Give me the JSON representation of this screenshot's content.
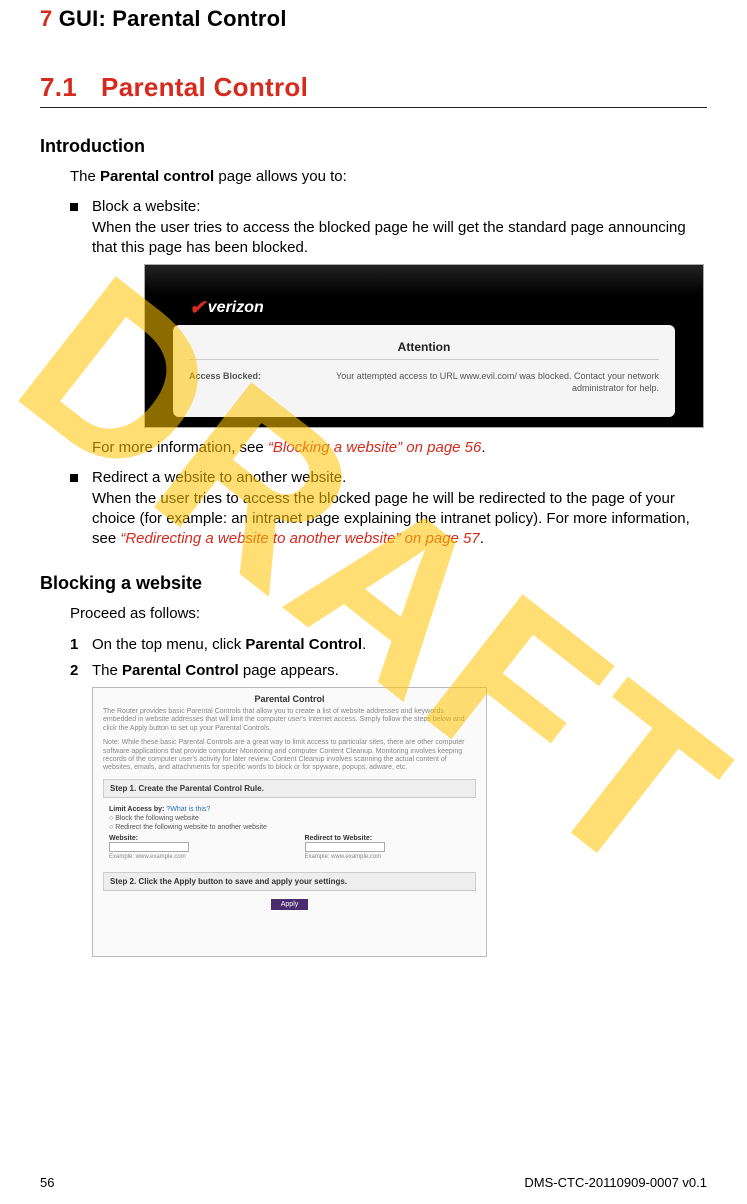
{
  "watermark": "DRAFT",
  "chapter": {
    "num": "7",
    "title": " GUI: Parental Control"
  },
  "section": {
    "num": "7.1",
    "title": "Parental Control"
  },
  "intro": {
    "heading": "Introduction",
    "lead_pre": "The ",
    "lead_bold": "Parental control",
    "lead_post": " page allows you to:",
    "bullets": [
      {
        "title": "Block a website:",
        "body": "When the user tries to access the blocked page he will get the standard page announcing that this page has been blocked.",
        "after_pre": "For more information, see ",
        "after_link": "“Blocking a website” on page 56",
        "after_post": "."
      },
      {
        "title": "Redirect a website to another website.",
        "body_pre": "When the user tries to access the blocked page he will be redirected to the page of your choice (for example: an intranet page explaining the intranet policy). For more information, see ",
        "body_link": "“Redirecting a website to another website” on page 57",
        "body_post": "."
      }
    ]
  },
  "verizon": {
    "logo": "verizon",
    "attention": "Attention",
    "row_label": "Access Blocked:",
    "row_text": "Your attempted access to URL www.evil.com/ was blocked. Contact your network administrator for help."
  },
  "blocking": {
    "heading": "Blocking a website",
    "proceed": "Proceed as follows:",
    "steps": [
      {
        "num": "1",
        "pre": "On the top menu, click ",
        "bold": "Parental Control",
        "post": "."
      },
      {
        "num": "2",
        "pre": "The ",
        "bold": "Parental Control",
        "post": " page appears."
      }
    ]
  },
  "pc_screen": {
    "title": "Parental Control",
    "para1": "The Router provides basic Parental Controls that allow you to create a list of website addresses and keywords embedded in website addresses that will limit the computer user's Internet access. Simply follow the steps below and click the Apply button to set up your Parental Controls.",
    "para2": "Note: While these basic Parental Controls are a great way to limit access to particular sites, there are other computer software applications that provide computer Monitoring and computer Content Cleanup. Monitoring involves keeping records of the computer user's activity for later review. Content Cleanup involves scanning the actual content of websites, emails, and attachments for specific words to block or for spyware, popups, adware, etc.",
    "step1": "Step 1. Create the Parental Control Rule.",
    "limit_label": "Limit Access by:",
    "what_is": "What is this?",
    "radio1": "Block the following website",
    "radio2": "Redirect the following website to another website",
    "website_label": "Website:",
    "redirect_label": "Redirect to Website:",
    "example": "Example: www.example.com",
    "step2": "Step 2. Click the Apply button to save and apply your settings.",
    "apply": "Apply"
  },
  "footer": {
    "page": "56",
    "doc": "DMS-CTC-20110909-0007 v0.1"
  }
}
